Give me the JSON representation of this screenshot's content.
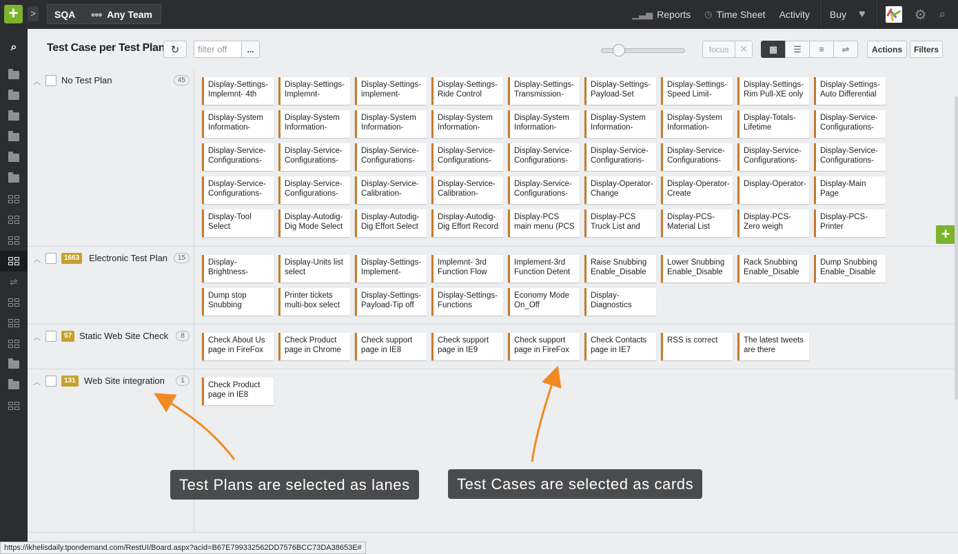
{
  "topbar": {
    "add_label": "+",
    "expand_label": ">",
    "project": "SQA",
    "team": "Any Team",
    "nav": [
      {
        "label": "Reports",
        "icon": "bar-chart-icon"
      },
      {
        "label": "Time Sheet",
        "icon": "clock-icon"
      },
      {
        "label": "Activity",
        "icon": ""
      }
    ],
    "buy": "Buy"
  },
  "header": {
    "title": "Test Case per Test Plan",
    "filter_placeholder": "filter off",
    "more_label": "...",
    "focus_label": "focus",
    "focus_close": "✕",
    "actions_label": "Actions",
    "filters_label": "Filters",
    "zoom_level": 0.2
  },
  "lanes": [
    {
      "id": "",
      "title": "No Test Plan",
      "count": "45",
      "cards": [
        "Display-Settings-Implemnt- 4th",
        "Display-Settings-Implemnt-",
        "Display-Settings-implement-",
        "Display-Settings-Ride Control",
        "Display-Settings-Transmission-",
        "Display-Settings-Payload-Set",
        "Display-Settings-Speed Limit-",
        "Display-Settings-Rim Pull-XE only",
        "Display-Settings-Auto Differential",
        "Display-System Information-",
        "Display-System Information-",
        "Display-System Information-",
        "Display-System Information-",
        "Display-System Information-",
        "Display-System Information-",
        "Display-System Information-",
        "Display-Totals-Lifetime",
        "Display-Service-Configurations-",
        "Display-Service-Configurations-",
        "Display-Service-Configurations-",
        "Display-Service-Configurations-",
        "Display-Service-Configurations-",
        "Display-Service-Configurations-",
        "Display-Service-Configurations-",
        "Display-Service-Configurations-",
        "Display-Service-Configurations-",
        "Display-Service-Configurations-",
        "Display-Service-Configurations-",
        "Display-Service-Configurations-",
        "Display-Service-Calibration-",
        "Display-Service-Calibration-",
        "Display-Service-Configurations-",
        "Display-Operator-Change",
        "Display-Operator-Create",
        "Display-Operator-",
        "Display-Main Page",
        "Display-Tool Select",
        "Display-Autodig-Dig Mode Select",
        "Display-Autodig-Dig Effort Select",
        "Display-Autodig-Dig Effort Record",
        "Display-PCS main menu (PCS",
        "Display-PCS Truck List and",
        "Display-PCS-Material List",
        "Display-PCS-Zero weigh",
        "Display-PCS-Printer"
      ]
    },
    {
      "id": "1663",
      "title": "Electronic Test Plan",
      "count": "15",
      "cards": [
        "Display-Brightness-",
        "Display-Units list select",
        "Display-Settings-Implement-",
        "Implemnt- 3rd Function Flow",
        "Implement-3rd Function Detent",
        "Raise Snubbing Enable_Disable",
        "Lower Snubbing Enable_Disable",
        "Rack Snubbing Enable_Disable",
        "Dump Snubbing Enable_Disable",
        "Dump stop Snubbing",
        "Printer tickets multi-box select",
        "Display-Settings-Payload-Tip off",
        "Display-Settings-Functions",
        "Economy Mode On_Off",
        "Display-Diagnostics"
      ]
    },
    {
      "id": "57",
      "title": "Static Web Site Check",
      "count": "8",
      "cards": [
        "Check About Us page in FireFox",
        "Check Product page in Chrome",
        "Check support page in IE8",
        "Check support page in IE9",
        "Check support page in FireFox",
        "Check Contacts page in IE7",
        "RSS is correct",
        "The latest tweets are there"
      ]
    },
    {
      "id": "131",
      "title": "Web Site integration",
      "count": "1",
      "cards": [
        "Check Product page in IE8"
      ]
    }
  ],
  "add_card_label": "+",
  "callouts": {
    "lanes": "Test Plans are selected as lanes",
    "cards": "Test Cases are selected as cards"
  },
  "statusbar": "https://ikhelisdaily.tpondemand.com/RestUI/Board.aspx?acid=B67E799332562DD7576BCC73DA38653E#",
  "colors": {
    "accent_green": "#7db22d",
    "card_border": "#c77a2c",
    "lane_id_badge": "#c9a02a",
    "callout_bg": "#4a4b4d",
    "arrow": "#f08a24"
  }
}
